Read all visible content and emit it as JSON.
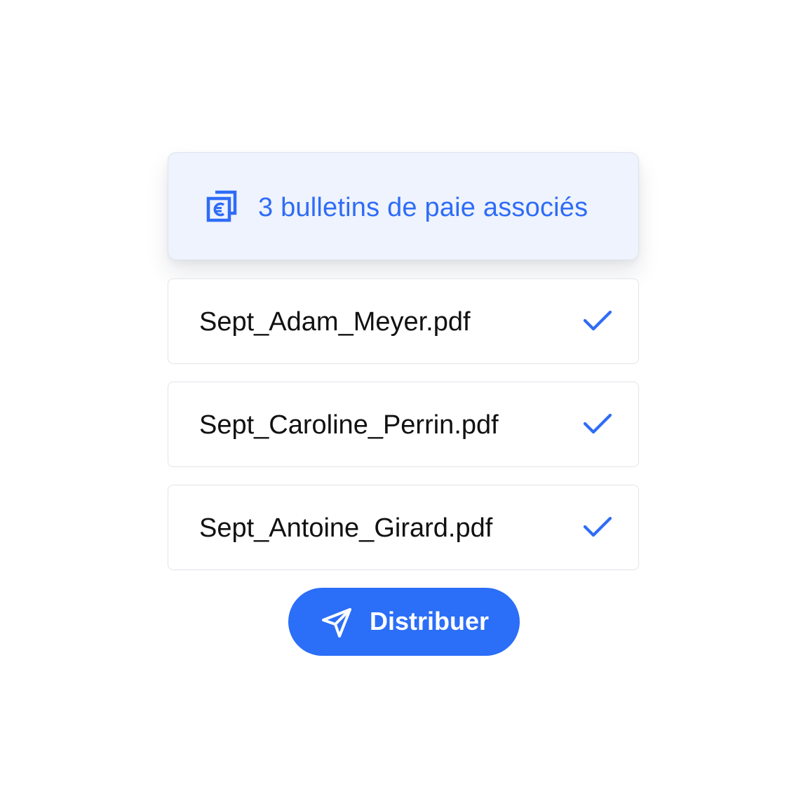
{
  "summary": {
    "text": "3 bulletins de paie associés",
    "icon": "stacked-euro-documents-icon",
    "accent_color": "#2f6cf6",
    "background_color": "#eef3fd"
  },
  "files": [
    {
      "name": "Sept_Adam_Meyer.pdf",
      "status": "check-icon"
    },
    {
      "name": "Sept_Caroline_Perrin.pdf",
      "status": "check-icon"
    },
    {
      "name": "Sept_Antoine_Girard.pdf",
      "status": "check-icon"
    }
  ],
  "action": {
    "label": "Distribuer",
    "icon": "send-icon",
    "color": "#2b6ef7"
  }
}
